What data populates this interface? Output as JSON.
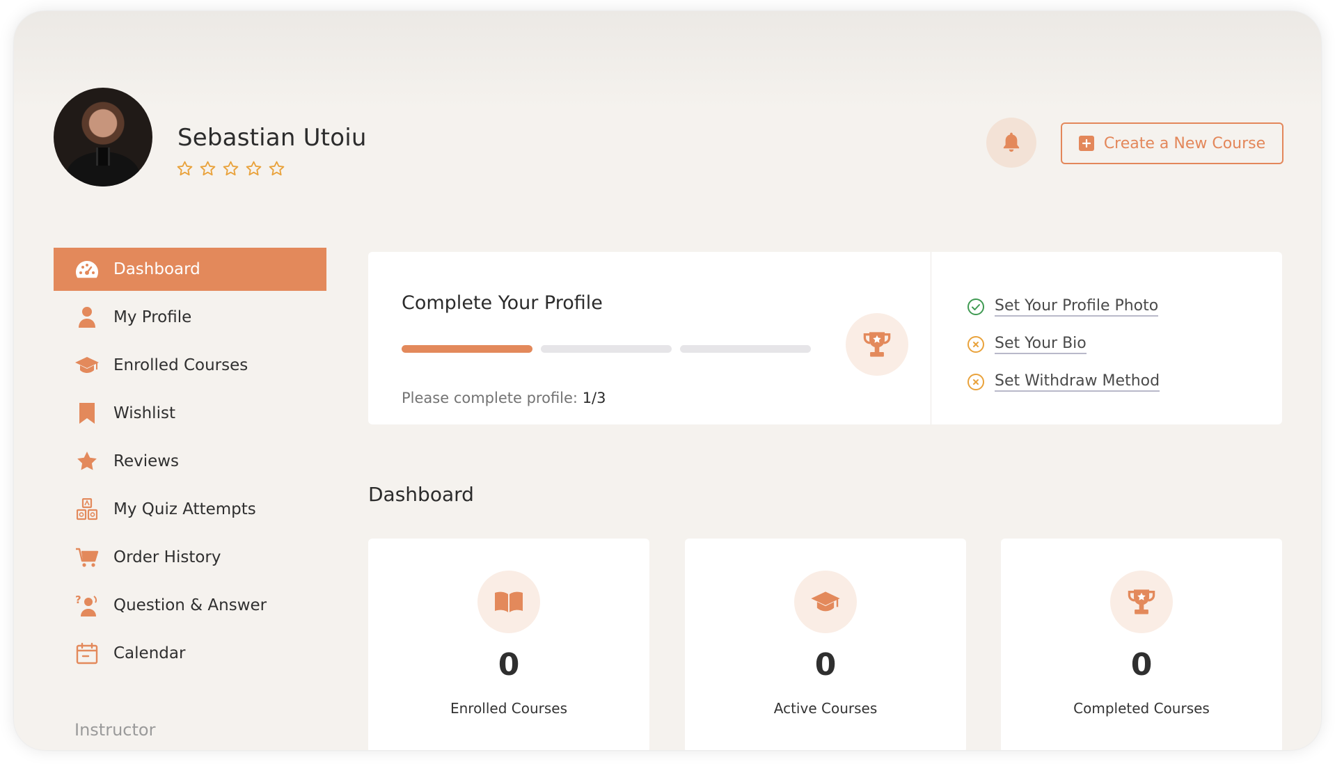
{
  "user": {
    "name": "Sebastian Utoiu",
    "rating_stars_filled": 0,
    "rating_stars_total": 5
  },
  "header": {
    "notifications_icon": "bell-icon",
    "create_course_label": "Create a New Course"
  },
  "sidebar": {
    "items": [
      {
        "label": "Dashboard",
        "icon": "dashboard-gauge-icon",
        "active": true
      },
      {
        "label": "My Profile",
        "icon": "user-icon",
        "active": false
      },
      {
        "label": "Enrolled Courses",
        "icon": "graduation-cap-icon",
        "active": false
      },
      {
        "label": "Wishlist",
        "icon": "bookmark-icon",
        "active": false
      },
      {
        "label": "Reviews",
        "icon": "star-icon",
        "active": false
      },
      {
        "label": "My Quiz Attempts",
        "icon": "quiz-blocks-icon",
        "active": false
      },
      {
        "label": "Order History",
        "icon": "cart-icon",
        "active": false
      },
      {
        "label": "Question & Answer",
        "icon": "question-person-icon",
        "active": false
      },
      {
        "label": "Calendar",
        "icon": "calendar-icon",
        "active": false
      }
    ],
    "section_label": "Instructor"
  },
  "profile_completion": {
    "title": "Complete Your Profile",
    "status_prefix": "Please complete profile:",
    "status_value": "1/3",
    "progress_completed": 1,
    "progress_total": 3,
    "checklist": [
      {
        "label": "Set Your Profile Photo",
        "done": true
      },
      {
        "label": "Set Your Bio",
        "done": false
      },
      {
        "label": "Set Withdraw Method",
        "done": false
      }
    ]
  },
  "dashboard": {
    "title": "Dashboard",
    "stats": [
      {
        "value": "0",
        "label": "Enrolled Courses",
        "icon": "book-open-icon"
      },
      {
        "value": "0",
        "label": "Active Courses",
        "icon": "graduation-cap-icon"
      },
      {
        "value": "0",
        "label": "Completed Courses",
        "icon": "trophy-icon"
      }
    ]
  },
  "colors": {
    "accent": "#e3895b",
    "background": "#f5f2ee",
    "icon_circle": "#faede5",
    "check_done": "#3f9a52",
    "check_pending": "#e9a23b"
  }
}
